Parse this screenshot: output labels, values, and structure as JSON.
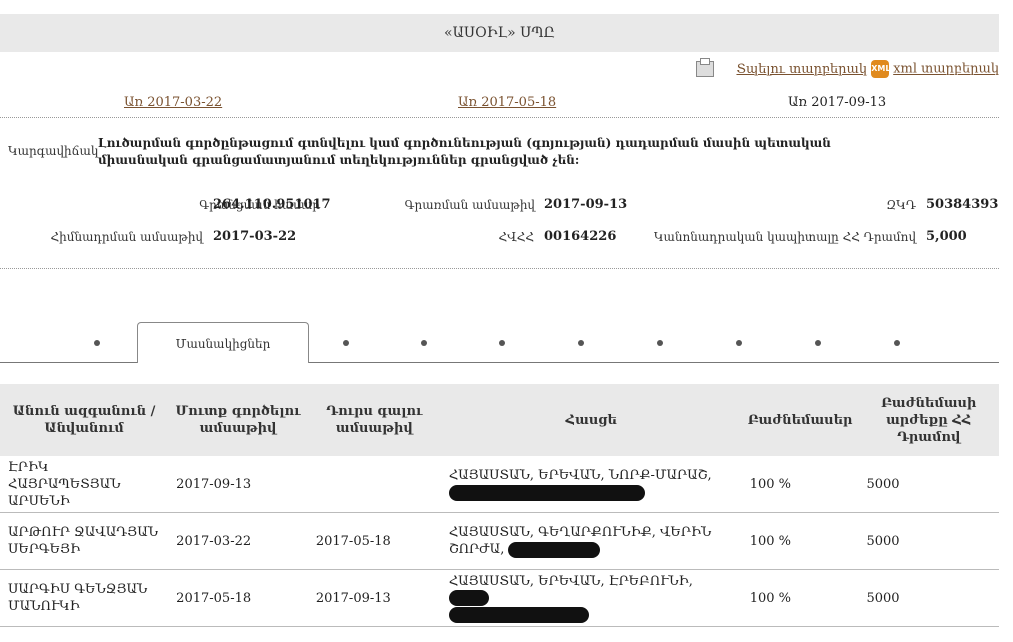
{
  "header": {
    "title": "«ԱՍՕԻԼ» ՍՊԸ"
  },
  "links": {
    "print": "Տպելու տարբերակ",
    "xml_badge": "XML",
    "xml": "xml տարբերակ"
  },
  "dates": {
    "first": "Առ 2017-03-22",
    "second": "Առ 2017-05-18",
    "current": "Առ 2017-09-13"
  },
  "intro": {
    "label": "Կարգավիճակ",
    "text": "Լուծարման գործընթացում գտնվելու կամ գործունեության (գոյության) դադարման մասին պետական միասնական գրանցամատյանում տեղեկություններ գրանցված չեն:"
  },
  "details": {
    "reg_number_label": "Գրանցման համար",
    "reg_number": "264.110.951017",
    "reg_date_label": "Գրառման ամսաթիվ",
    "reg_date": "2017-09-13",
    "zkd_label": "ԶԿԴ",
    "zkd": "50384393",
    "founding_date_label": "Հիմնադրման ամսաթիվ",
    "founding_date": "2017-03-22",
    "tin_label": "ՀՎՀՀ",
    "tin": "00164226",
    "capital_label": "Կանոնադրական կապիտալը ՀՀ Դրամով",
    "capital": "5,000"
  },
  "tabs": {
    "active": "Մասնակիցներ"
  },
  "table": {
    "headers": [
      "Անուն ազգանուն / Անվանում",
      "Մուտք գործելու ամսաթիվ",
      "Դուրս գալու ամսաթիվ",
      "Հասցե",
      "Բաժնեմասեր",
      "Բաժնեմասի արժեքը ՀՀ Դրամով"
    ],
    "rows": [
      {
        "name": "ԷՐԻԿ ՀԱՅՐԱՊԵՏՅԱՆ ԱՐՍԵՆԻ",
        "entry": "2017-09-13",
        "exit": "",
        "address": "ՀԱՅԱՍՏԱՆ, ԵՐԵՎԱՆ, ՆՈՐՔ-ՄԱՐԱՇ,",
        "share": "100 %",
        "value": "5000"
      },
      {
        "name": "ԱՐԹՈՒՐ ՋԱՎԱԴՅԱՆ ՍԵՐԳԵՅԻ",
        "entry": "2017-03-22",
        "exit": "2017-05-18",
        "address": "ՀԱՅԱՍՏԱՆ, ԳԵՂԱՐՔՈՒՆԻՔ, ՎԵՐԻՆ ՇՈՐԺԱ,",
        "share": "100 %",
        "value": "5000"
      },
      {
        "name": "ՍԱՐԳԻՍ ԳԵՆՋՅԱՆ ՄԱՆՈՒԿԻ",
        "entry": "2017-05-18",
        "exit": "2017-09-13",
        "address": "ՀԱՅԱՍՏԱՆ, ԵՐԵՎԱՆ, ԷՐԵԲՈՒՆԻ,",
        "share": "100 %",
        "value": "5000"
      }
    ]
  }
}
